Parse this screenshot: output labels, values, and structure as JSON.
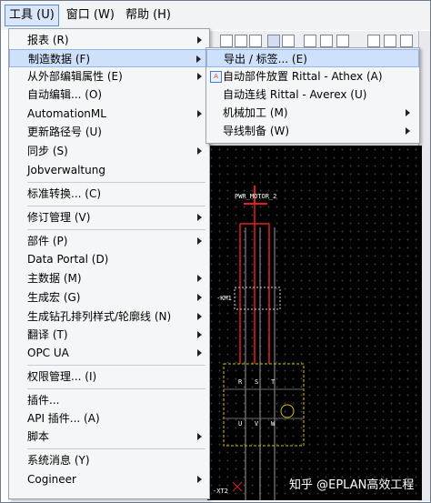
{
  "menubar": {
    "tools": "工具 (U)",
    "window": "窗口 (W)",
    "help": "帮助 (H)"
  },
  "menu": {
    "items": [
      {
        "label": "报表 (R)",
        "submenu": true
      },
      {
        "label": "制造数据 (F)",
        "submenu": true,
        "highlighted": true
      },
      {
        "label": "从外部编辑属性 (E)",
        "submenu": true
      },
      {
        "label": "自动编辑... (O)",
        "submenu": false
      },
      {
        "label": "AutomationML",
        "submenu": true
      },
      {
        "label": "更新路径号 (U)",
        "submenu": false
      },
      {
        "label": "同步 (S)",
        "submenu": true
      },
      {
        "label": "Jobverwaltung",
        "submenu": false
      },
      {
        "label": "标准转换... (C)",
        "submenu": false
      },
      {
        "label": "修订管理 (V)",
        "submenu": true
      },
      {
        "label": "部件 (P)",
        "submenu": true
      },
      {
        "label": "Data Portal (D)",
        "submenu": false
      },
      {
        "label": "主数据 (M)",
        "submenu": true
      },
      {
        "label": "生成宏 (G)",
        "submenu": true
      },
      {
        "label": "生成钻孔排列样式/轮廓线 (N)",
        "submenu": true
      },
      {
        "label": "翻译 (T)",
        "submenu": true
      },
      {
        "label": "OPC UA",
        "submenu": true
      },
      {
        "label": "权限管理... (I)",
        "submenu": false
      },
      {
        "label": "插件...",
        "submenu": false
      },
      {
        "label": "API 插件... (A)",
        "submenu": false
      },
      {
        "label": "脚本",
        "submenu": true
      },
      {
        "label": "系统消息 (Y)",
        "submenu": false
      },
      {
        "label": "Cogineer",
        "submenu": true
      }
    ]
  },
  "submenu": {
    "items": [
      {
        "label": "导出 / 标签... (E)",
        "submenu": false,
        "highlighted": true
      },
      {
        "label": "自动部件放置 Rittal - Athex (A)",
        "submenu": false,
        "icon": "rittal-place-icon"
      },
      {
        "label": "自动连线 Rittal - Averex (U)",
        "submenu": false
      },
      {
        "label": "机械加工 (M)",
        "submenu": true
      },
      {
        "label": "导线制备 (W)",
        "submenu": true
      }
    ]
  },
  "canvas": {
    "motor_tag": "PWR_MOTOR_2",
    "contactor_tag": "-KM1",
    "terminal_top": [
      "R",
      "S",
      "T"
    ],
    "terminal_bottom": [
      "U",
      "V",
      "W"
    ],
    "bottom_tag": "-XT2"
  },
  "watermark": "知乎 @EPLAN高效工程",
  "colors": {
    "highlight_bg": "#cfe0fb",
    "canvas_bg": "#000000",
    "wire_red": "#e02020",
    "wire_gray": "#9a9a9a",
    "terminal_yellow": "#d8c000"
  }
}
